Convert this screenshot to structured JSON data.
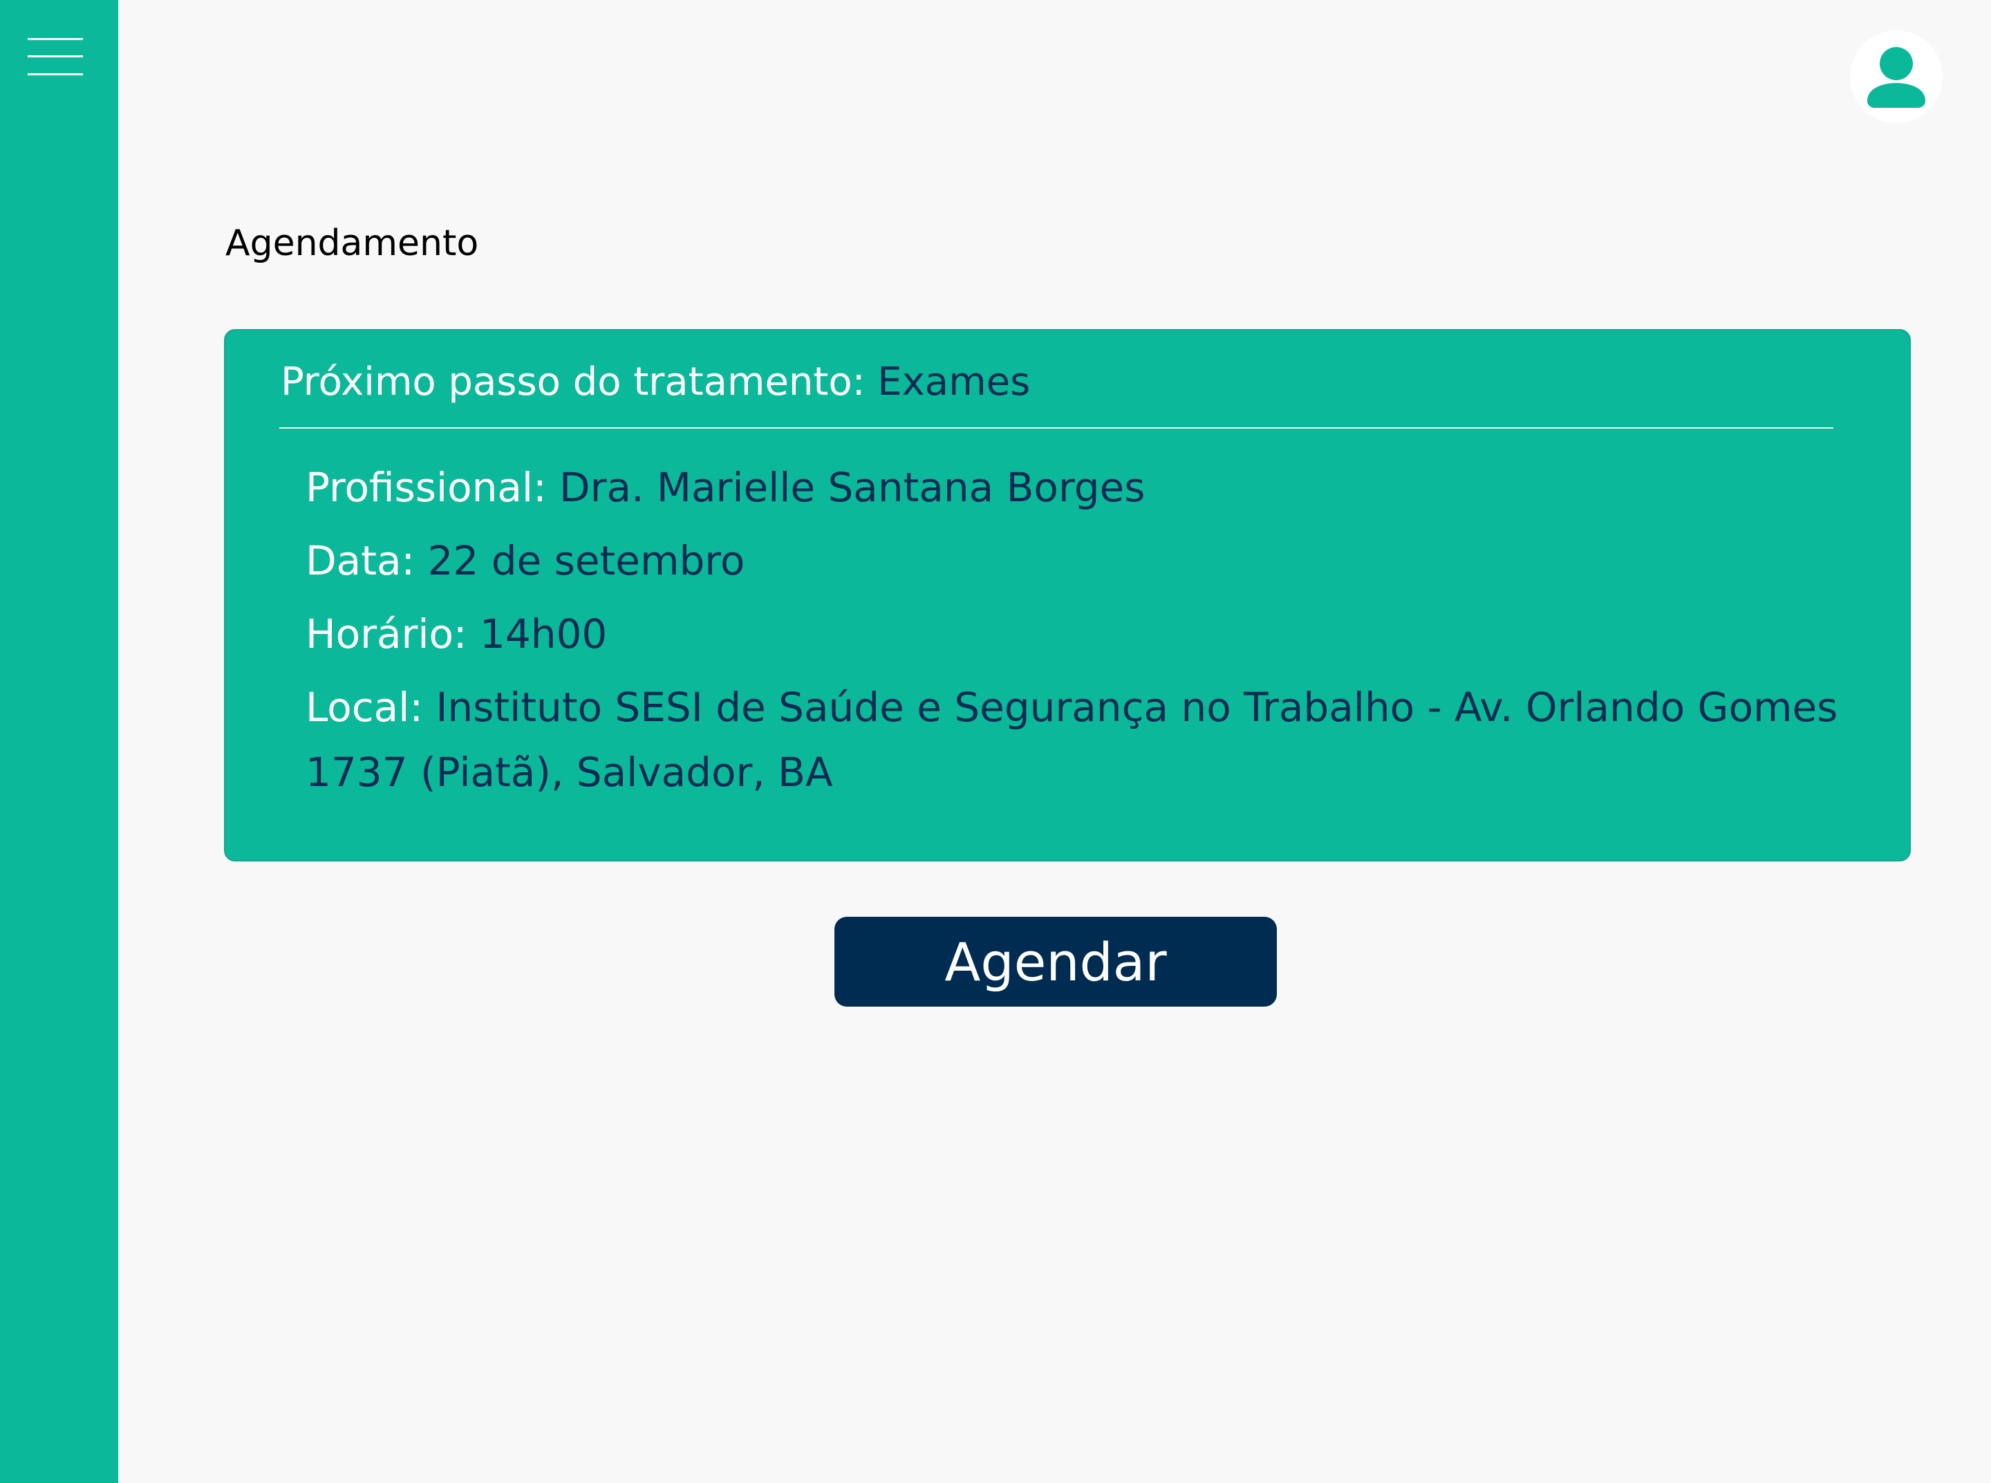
{
  "sidebar": {
    "menu_icon": "hamburger-menu-icon",
    "color": "#0cb89a"
  },
  "header": {
    "avatar_icon": "user-icon"
  },
  "page": {
    "title": "Agendamento"
  },
  "card": {
    "next_step_label": "Próximo passo do tratamento:",
    "next_step_value": "Exames",
    "professional_label": "Profissional:",
    "professional_value": "Dra. Marielle Santana Borges",
    "date_label": "Data:",
    "date_value": "22 de setembro",
    "time_label": "Horário:",
    "time_value": "14h00",
    "location_label": "Local:",
    "location_value": "Instituto SESI de Saúde e Segurança no Trabalho - Av. Orlando Gomes 1737 (Piatã), Salvador, BA"
  },
  "actions": {
    "schedule_label": "Agendar"
  },
  "colors": {
    "accent": "#0cb89a",
    "value_text": "#0b2c52",
    "button_bg": "#002c52",
    "background": "#f8f8f8"
  }
}
